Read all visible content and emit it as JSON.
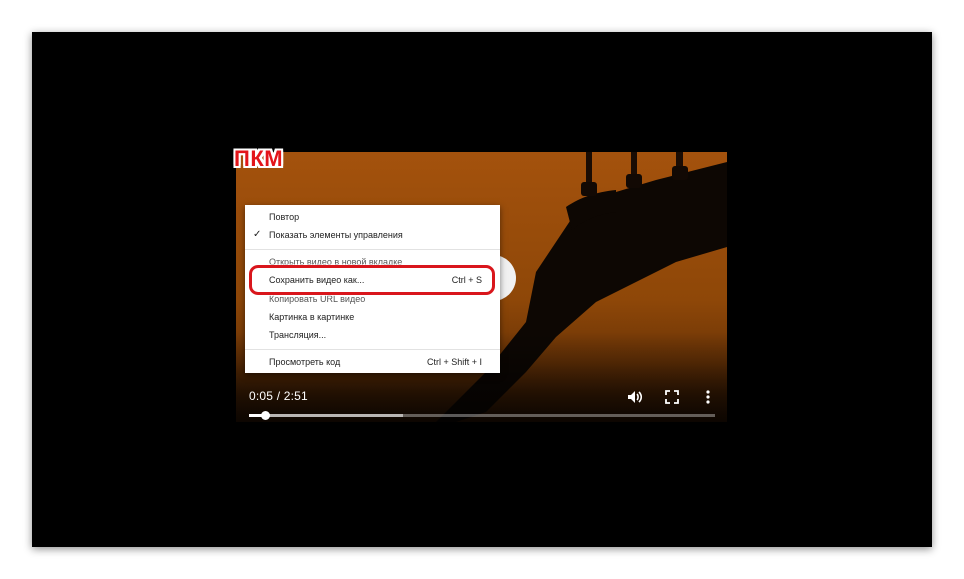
{
  "annotation": {
    "label": "ПКМ"
  },
  "player": {
    "time_display": "0:05 / 2:51",
    "progress_played": 0.035,
    "progress_buffered": 0.33,
    "icons": [
      "volume-icon",
      "fullscreen-icon",
      "more-options-icon"
    ]
  },
  "context_menu": {
    "items": [
      {
        "label": "Повтор",
        "shortcut": "",
        "checked": false
      },
      {
        "label": "Показать элементы управления",
        "shortcut": "",
        "checked": true
      },
      {
        "label": "Открыть видео в новой вкладке",
        "shortcut": "",
        "checked": false
      },
      {
        "label": "Сохранить видео как...",
        "shortcut": "Ctrl + S",
        "checked": false
      },
      {
        "label": "Копировать URL видео",
        "shortcut": "",
        "checked": false
      },
      {
        "label": "Картинка в картинке",
        "shortcut": "",
        "checked": false
      },
      {
        "label": "Трансляция...",
        "shortcut": "",
        "checked": false
      },
      {
        "label": "Просмотреть код",
        "shortcut": "Ctrl + Shift + I",
        "checked": false
      }
    ]
  },
  "colors": {
    "highlight": "#d9161c",
    "video_orange": "#a4520d"
  }
}
